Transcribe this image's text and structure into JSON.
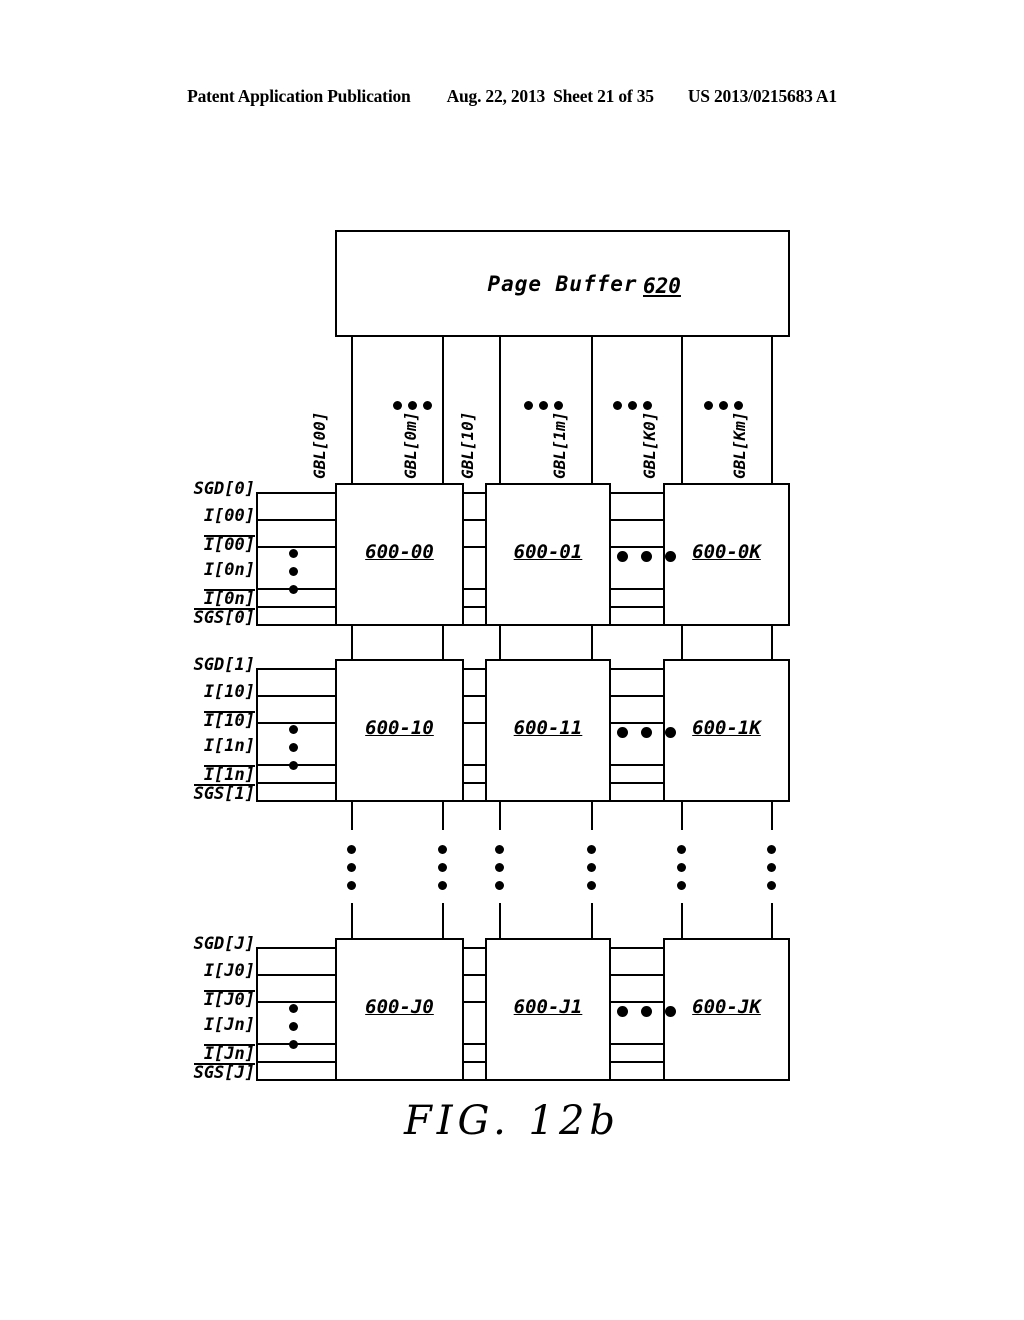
{
  "header": {
    "publication": "Patent Application Publication",
    "date": "Aug. 22, 2013",
    "sheet": "Sheet 21 of 35",
    "patent_number": "US 2013/0215683 A1"
  },
  "figure": {
    "caption": "FIG.  12b",
    "page_buffer": {
      "title": "Page Buffer",
      "reference": "620"
    },
    "bitlines": [
      {
        "label": "GBL[00]"
      },
      {
        "label": "GBL[0m]"
      },
      {
        "label": "GBL[10]"
      },
      {
        "label": "GBL[1m]"
      },
      {
        "label": "GBL[K0]"
      },
      {
        "label": "GBL[Km]"
      }
    ],
    "bitline_ellipses": [
      "•••",
      "•••",
      "•••",
      "•••"
    ],
    "rows": [
      {
        "index": "0",
        "signals": [
          {
            "text": "SGD[0]",
            "overline": false
          },
          {
            "text": "I[00]",
            "overline": false
          },
          {
            "text": "I[00]",
            "overline": true
          },
          {
            "text": "I[0n]",
            "overline": false
          },
          {
            "text": "I[0n]",
            "overline": true
          },
          {
            "text": "SGS[0]",
            "overline": true
          }
        ],
        "blocks": [
          {
            "label": "600-00"
          },
          {
            "label": "600-01"
          },
          {
            "label": "600-0K"
          }
        ]
      },
      {
        "index": "1",
        "signals": [
          {
            "text": "SGD[1]",
            "overline": false
          },
          {
            "text": "I[10]",
            "overline": false
          },
          {
            "text": "I[10]",
            "overline": true
          },
          {
            "text": "I[1n]",
            "overline": false
          },
          {
            "text": "I[1n]",
            "overline": true
          },
          {
            "text": "SGS[1]",
            "overline": true
          }
        ],
        "blocks": [
          {
            "label": "600-10"
          },
          {
            "label": "600-11"
          },
          {
            "label": "600-1K"
          }
        ]
      },
      {
        "index": "J",
        "signals": [
          {
            "text": "SGD[J]",
            "overline": false
          },
          {
            "text": "I[J0]",
            "overline": false
          },
          {
            "text": "I[J0]",
            "overline": true
          },
          {
            "text": "I[Jn]",
            "overline": false
          },
          {
            "text": "I[Jn]",
            "overline": true
          },
          {
            "text": "SGS[J]",
            "overline": true
          }
        ],
        "blocks": [
          {
            "label": "600-J0"
          },
          {
            "label": "600-J1"
          },
          {
            "label": "600-JK"
          }
        ]
      }
    ]
  },
  "colors": {
    "ink": "#000000",
    "paper": "#ffffff"
  }
}
